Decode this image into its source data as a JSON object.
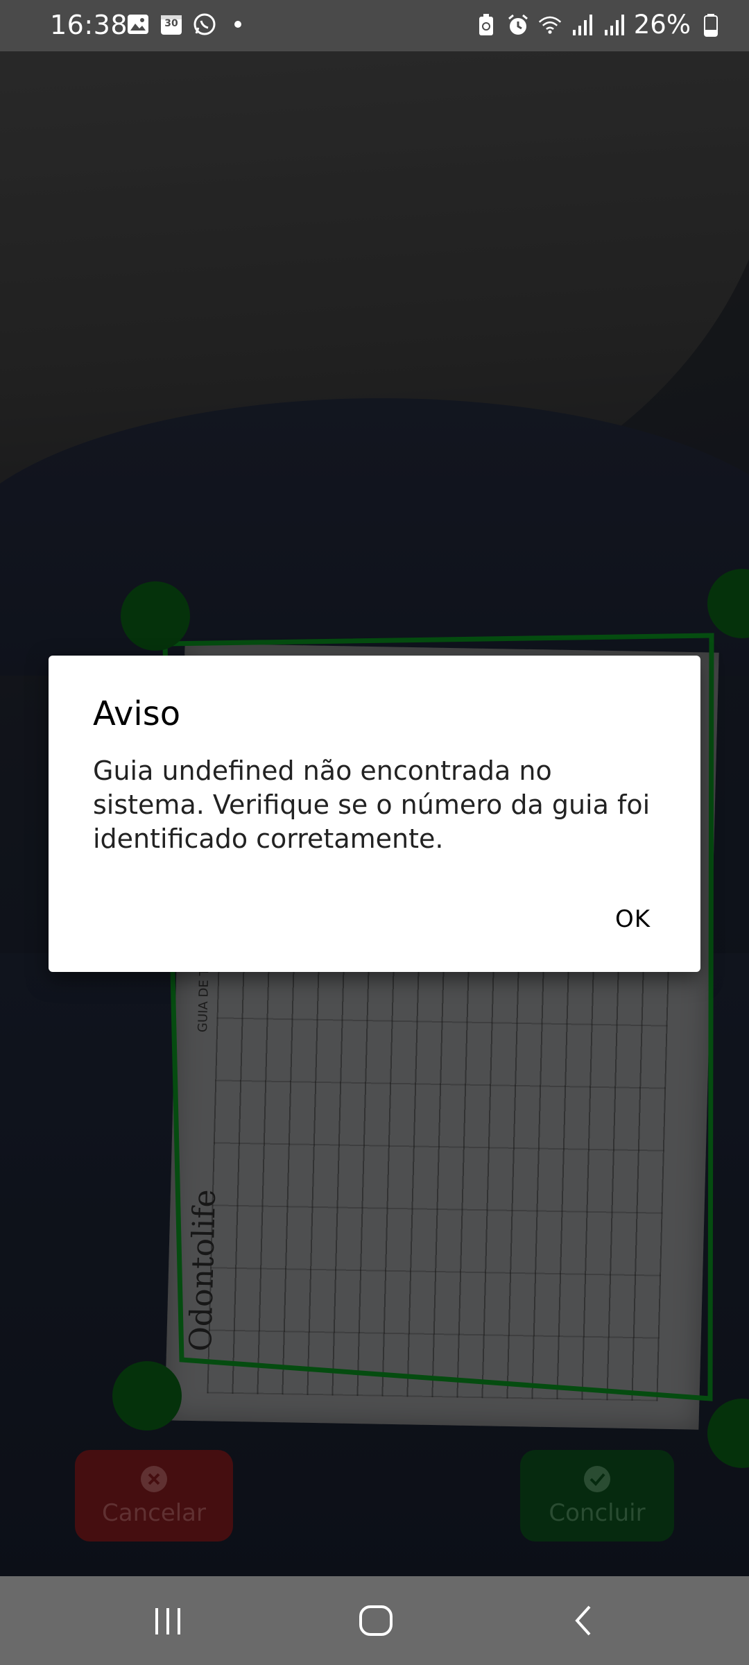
{
  "status_bar": {
    "time": "16:38",
    "battery": "26%",
    "left_icons": [
      "gallery-icon",
      "calendar-icon",
      "whatsapp-icon",
      "dot-icon"
    ],
    "calendar_day": "30",
    "right_icons": [
      "battery-saver-icon",
      "alarm-icon",
      "wifi-icon",
      "signal-icon",
      "signal-icon",
      "battery-icon"
    ]
  },
  "scanner": {
    "cancel_label": "Cancelar",
    "conclude_label": "Concluir",
    "outline_color": "#0a8a1e",
    "handle_color": "#0a5c14",
    "document": {
      "title": "GUIA DE TRATAMENTO OD",
      "logo": "Odontolife"
    }
  },
  "dialog": {
    "title": "Aviso",
    "message": "Guia undefined não encontrada no sistema. Verifique se o número da guia foi identificado corretamente.",
    "ok_label": "OK"
  },
  "nav_bar": {
    "icons": [
      "recent-apps-icon",
      "home-icon",
      "back-icon"
    ]
  }
}
